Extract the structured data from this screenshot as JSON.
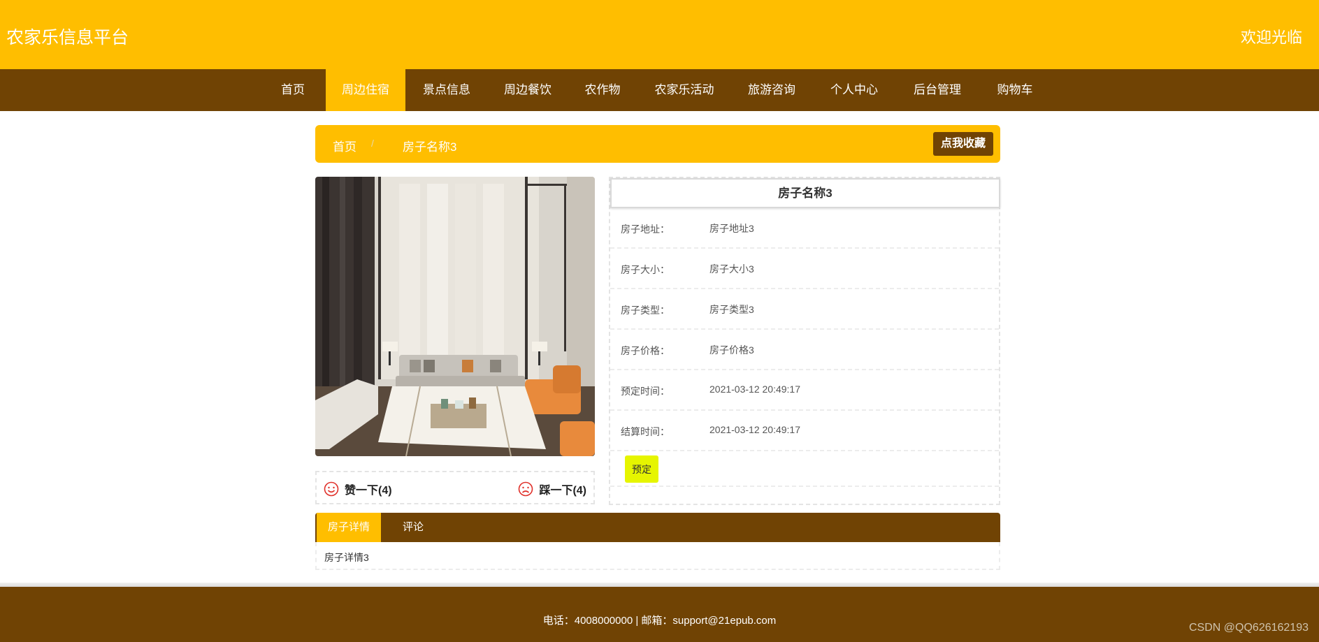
{
  "header": {
    "site_title": "农家乐信息平台",
    "welcome": "欢迎光临"
  },
  "nav": {
    "items": [
      "首页",
      "周边住宿",
      "景点信息",
      "周边餐饮",
      "农作物",
      "农家乐活动",
      "旅游咨询",
      "个人中心",
      "后台管理",
      "购物车"
    ],
    "active_index": 1
  },
  "breadcrumb": {
    "home": "首页",
    "separator": "/",
    "current": "房子名称3",
    "favorite_button": "点我收藏"
  },
  "reactions": {
    "like": "赞一下(4)",
    "dislike": "踩一下(4)"
  },
  "details": {
    "title": "房子名称3",
    "rows": [
      {
        "label": "房子地址：",
        "value": "房子地址3"
      },
      {
        "label": "房子大小：",
        "value": "房子大小3"
      },
      {
        "label": "房子类型：",
        "value": "房子类型3"
      },
      {
        "label": "房子价格：",
        "value": "房子价格3"
      },
      {
        "label": "预定时间：",
        "value": "2021-03-12 20:49:17"
      },
      {
        "label": "结算时间：",
        "value": "2021-03-12 20:49:17"
      }
    ],
    "book_button": "预定"
  },
  "tabs": {
    "items": [
      "房子详情",
      "评论"
    ],
    "active_index": 0,
    "content": "房子详情3"
  },
  "footer": {
    "text": "电话：4008000000 | 邮箱：support@21epub.com",
    "watermark": "CSDN @QQ626162193"
  },
  "colors": {
    "primary_yellow": "#ffbe00",
    "brown": "#704304",
    "book_button": "#e6f500",
    "icon_red": "#e0302a"
  }
}
